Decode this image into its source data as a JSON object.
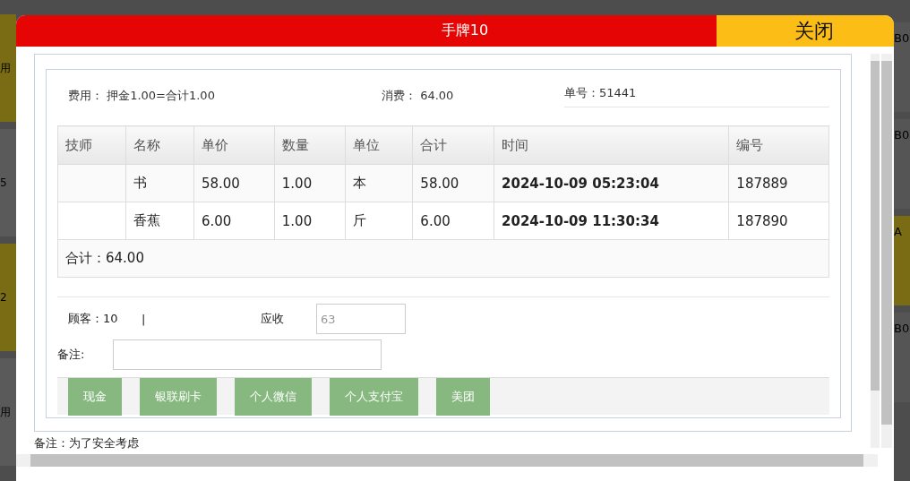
{
  "background_page": {
    "left_fragments": [
      "用",
      "5",
      "2",
      "用"
    ],
    "right_cards": [
      {
        "title": "B0"
      },
      {
        "title": "B0"
      },
      {
        "title": "A"
      },
      {
        "title": "B0"
      }
    ]
  },
  "dialog": {
    "title": "手牌10",
    "close_button": "关闭",
    "summary": {
      "fee": "费用： 押金1.00=合计1.00",
      "consumption": "消费： 64.00",
      "order_no": "单号：51441"
    },
    "table": {
      "columns": [
        "技师",
        "名称",
        "单价",
        "数量",
        "单位",
        "合计",
        "时间",
        "编号"
      ],
      "rows": [
        [
          "",
          "书",
          "58.00",
          "1.00",
          "本",
          "58.00",
          "2024-10-09 05:23:04",
          "187889"
        ],
        [
          "",
          "香蕉",
          "6.00",
          "1.00",
          "斤",
          "6.00",
          "2024-10-09 11:30:34",
          "187890"
        ]
      ],
      "total": "合计：64.00"
    },
    "customer": "顾客：10",
    "separator": "|",
    "receivable_label": "应收",
    "receivable_placeholder": "63",
    "remark_label": "备注:",
    "payment_buttons": [
      "现金",
      "银联刷卡",
      "个人微信",
      "个人支付宝",
      "美团"
    ],
    "footnote": "备注：为了安全考虑"
  }
}
